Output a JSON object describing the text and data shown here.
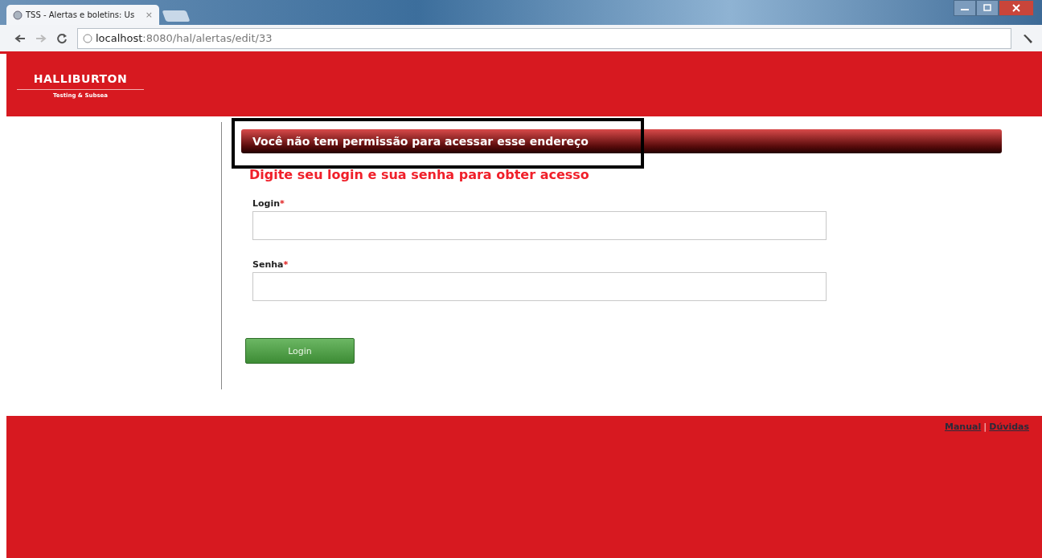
{
  "browser": {
    "tab_title": "TSS - Alertas e boletins: Us",
    "tab_close": "×",
    "url_host": "localhost",
    "url_path": ":8080/hal/alertas/edit/33"
  },
  "header": {
    "logo": "HALLIBURTON",
    "subtitle": "Testing & Subsea"
  },
  "banner": {
    "text": "Você não tem permissão para acessar esse endereço",
    "highlighted": true
  },
  "heading": "Digite seu login e sua senha para obter acesso",
  "fields": [
    {
      "label": "Login",
      "required": "*"
    },
    {
      "label": "Senha",
      "required": "*"
    }
  ],
  "submit": "Login",
  "footer": {
    "links": [
      "Manual",
      "Dúvidas"
    ],
    "separator": "|"
  }
}
